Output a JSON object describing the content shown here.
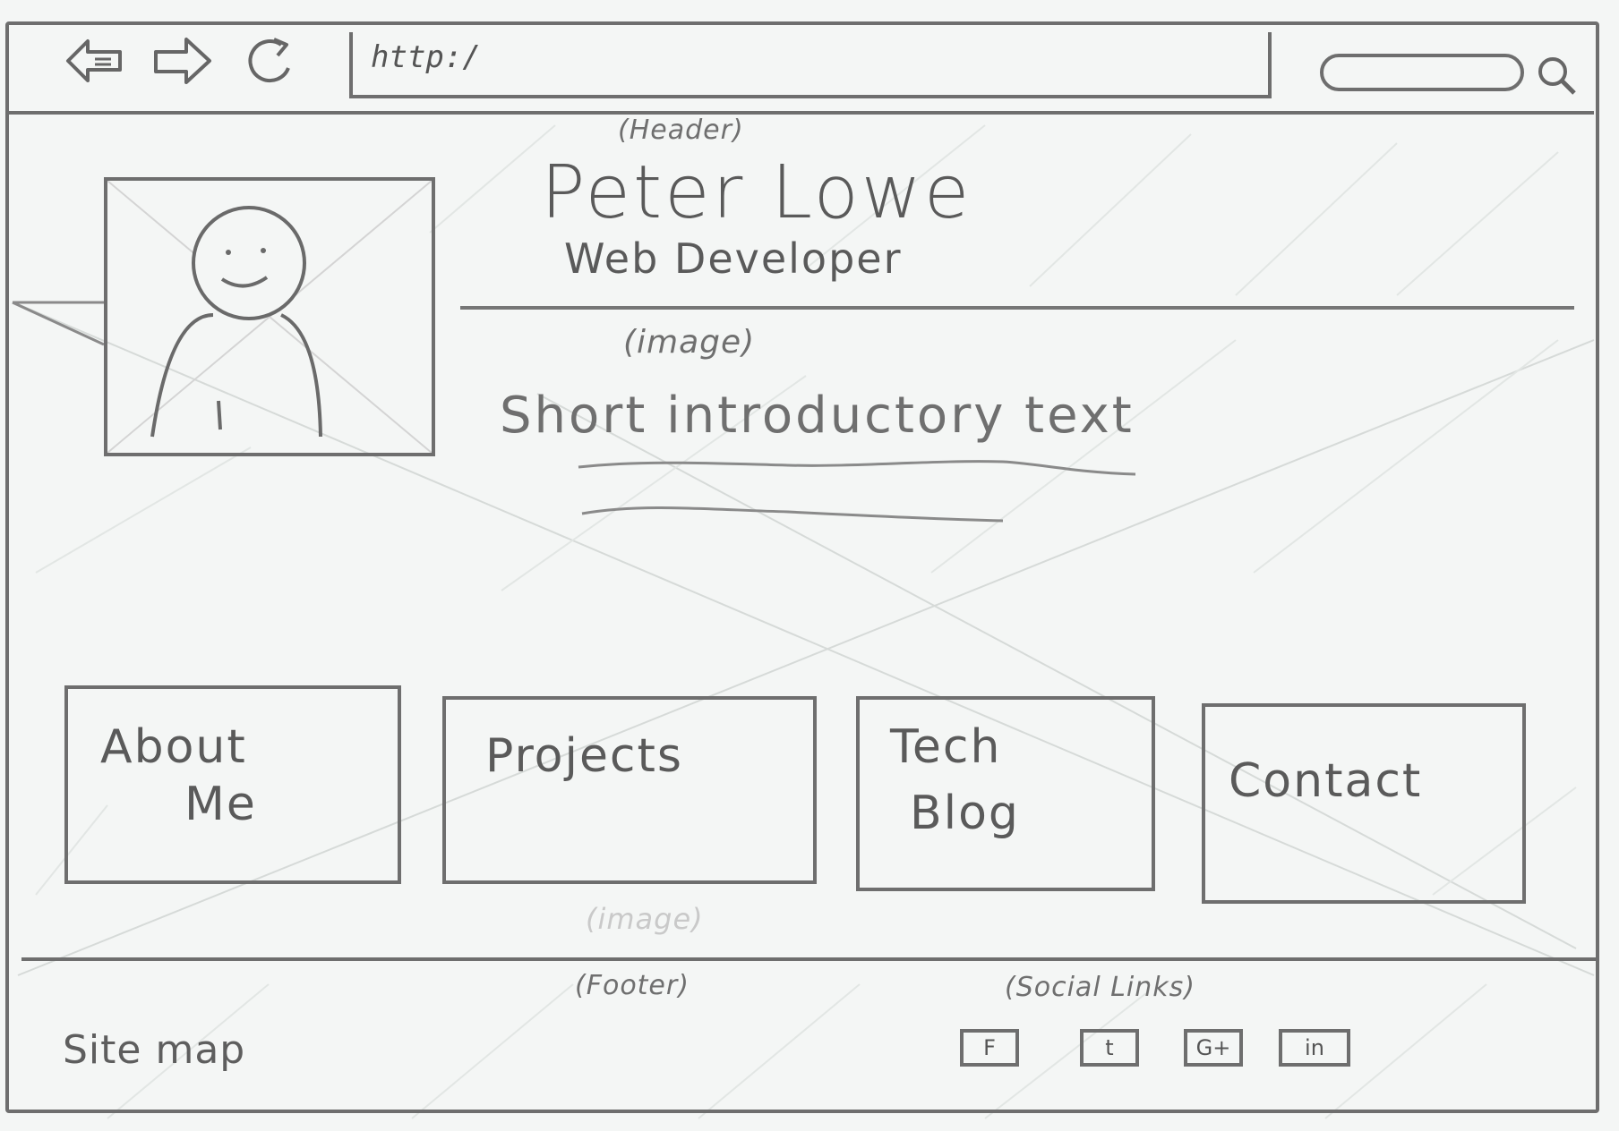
{
  "browser": {
    "url": "http:/",
    "back_icon": "back-arrow-icon",
    "forward_icon": "forward-arrow-icon",
    "reload_icon": "reload-icon",
    "search_icon": "search-icon"
  },
  "annotations": {
    "header": "(Header)",
    "image_top": "(image)",
    "image_bottom": "(image)",
    "footer": "(Footer)",
    "social": "(Social Links)"
  },
  "header": {
    "name": "Peter Lowe",
    "role": "Web Developer",
    "intro": "Short introductory text"
  },
  "tiles": [
    {
      "line1": "About",
      "line2": "Me"
    },
    {
      "line1": "Projects",
      "line2": ""
    },
    {
      "line1": "Tech",
      "line2": "Blog"
    },
    {
      "line1": "Contact",
      "line2": ""
    }
  ],
  "footer": {
    "sitemap": "Site map",
    "social_links": [
      {
        "label": "F",
        "icon": "facebook-icon"
      },
      {
        "label": "t",
        "icon": "twitter-icon"
      },
      {
        "label": "G+",
        "icon": "google-plus-icon"
      },
      {
        "label": "in",
        "icon": "linkedin-icon"
      }
    ]
  }
}
